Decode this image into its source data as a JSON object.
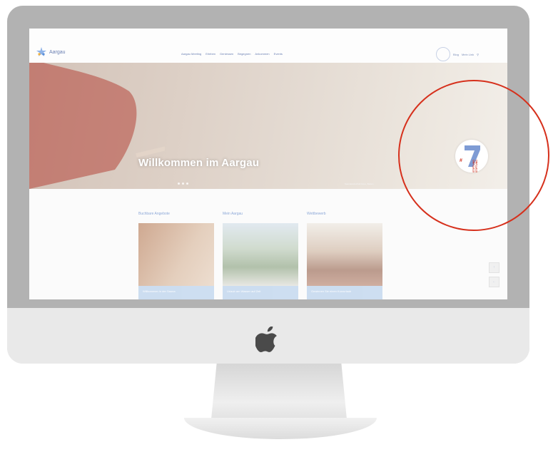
{
  "site": {
    "brand_name": "Aargau",
    "nav_items": [
      "Aargau Meeting",
      "Erleben",
      "Geniessen",
      "Begegnen",
      "Ankommen",
      "Events"
    ],
    "nav_right": [
      "Blog",
      "Mein Link"
    ],
    "hero": {
      "title": "Willkommen im Aargau",
      "credit": "Saunalandschaft Fiore, Baden"
    },
    "sections": [
      {
        "heading": "Buchbare Angebote",
        "card_label": "Willkommen in der Sauna"
      },
      {
        "heading": "Mein Aargau",
        "card_label": "Urlaub am Wasser auf Zeit"
      },
      {
        "heading": "Wettbewerb",
        "card_label": "Gewinnen Sie einen Kurzurlaub"
      }
    ],
    "side_buttons": [
      "↑",
      "←"
    ]
  },
  "callout": {
    "badge_hash": "#",
    "badge_lines": "STIFTUNG STIFTUNG"
  },
  "colors": {
    "accent_blue": "#6a7fb2",
    "callout_red": "#d6301c",
    "card_label": "#c4d8ef"
  }
}
